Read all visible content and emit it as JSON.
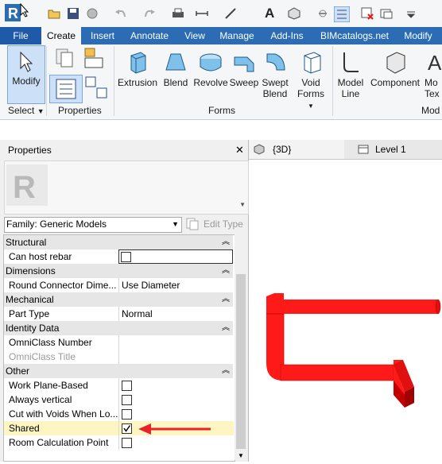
{
  "tabs": [
    "File",
    "Create",
    "Insert",
    "Annotate",
    "View",
    "Manage",
    "Add-Ins",
    "BIMcatalogs.net",
    "Modify"
  ],
  "ribbon": {
    "modify_label": "Modify",
    "forms_buttons": [
      "Extrusion",
      "Blend",
      "Revolve",
      "Sweep",
      "Swept",
      "Void",
      "Model",
      "Component",
      "Mo"
    ],
    "forms_buttons_line2": [
      "Blend",
      "Forms",
      "Line",
      "Tex"
    ],
    "panel_select": "Select",
    "panel_properties": "Properties",
    "panel_forms": "Forms",
    "panel_model": "Mod"
  },
  "properties": {
    "title": "Properties",
    "close": "✕",
    "family_selector": "Family: Generic Models",
    "edit_type": "Edit Type",
    "categories": {
      "structural": "Structural",
      "dimensions": "Dimensions",
      "mechanical": "Mechanical",
      "identity": "Identity Data",
      "other": "Other"
    },
    "params": {
      "can_host_rebar": "Can host rebar",
      "round_connector": "Round Connector Dime...",
      "round_connector_value": "Use Diameter",
      "part_type": "Part Type",
      "part_type_value": "Normal",
      "omniclass_number": "OmniClass Number",
      "omniclass_title": "OmniClass Title",
      "work_plane_based": "Work Plane-Based",
      "always_vertical": "Always vertical",
      "cut_with_voids": "Cut with Voids When Lo...",
      "shared": "Shared",
      "room_calc": "Room Calculation Point"
    },
    "shared_checked": true
  },
  "view_tabs": {
    "view_3d": "{3D}",
    "level_1": "Level 1"
  },
  "colors": {
    "accent_blue": "#2b6cb5",
    "model_red": "#ff1a1a",
    "arrow_red": "#e8212b",
    "highlight": "#fdf6c3"
  }
}
